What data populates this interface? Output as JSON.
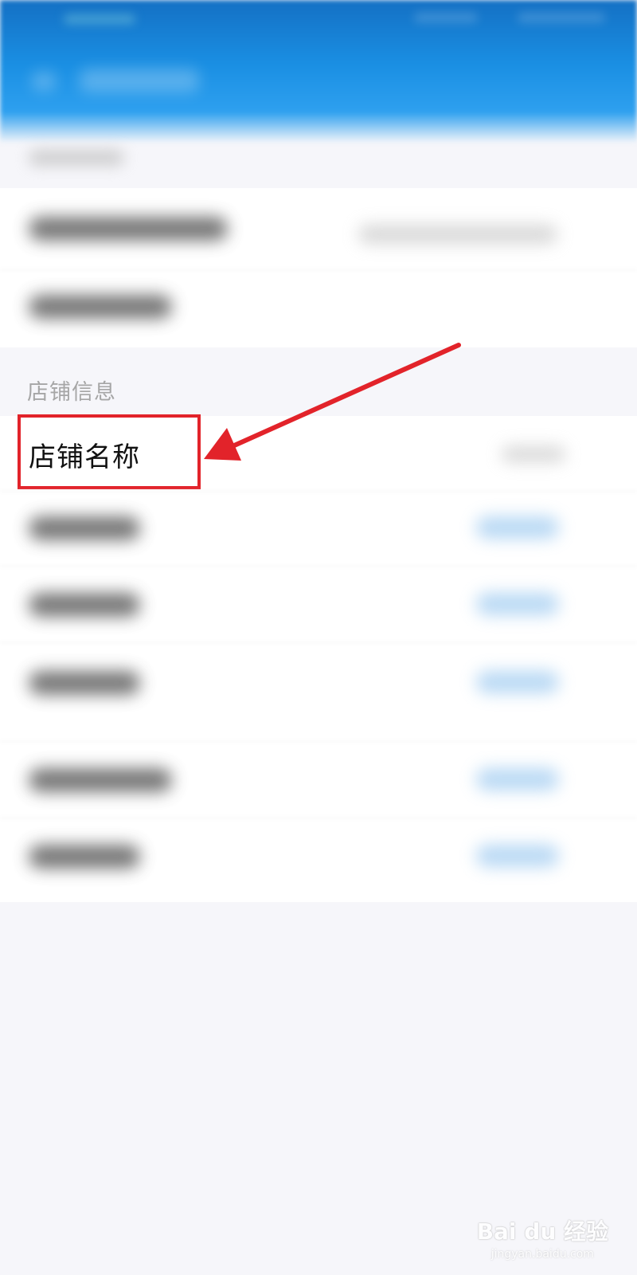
{
  "shop_info": {
    "section_label": "店铺信息",
    "shop_name_label": "店铺名称"
  },
  "annotation": {
    "highlight_color": "#e2232a"
  },
  "watermark": {
    "main": "Bai du 经验",
    "sub": "jingyan.baidu.com"
  },
  "colors": {
    "header": "#1a8fe3",
    "background": "#f6f6fa"
  }
}
